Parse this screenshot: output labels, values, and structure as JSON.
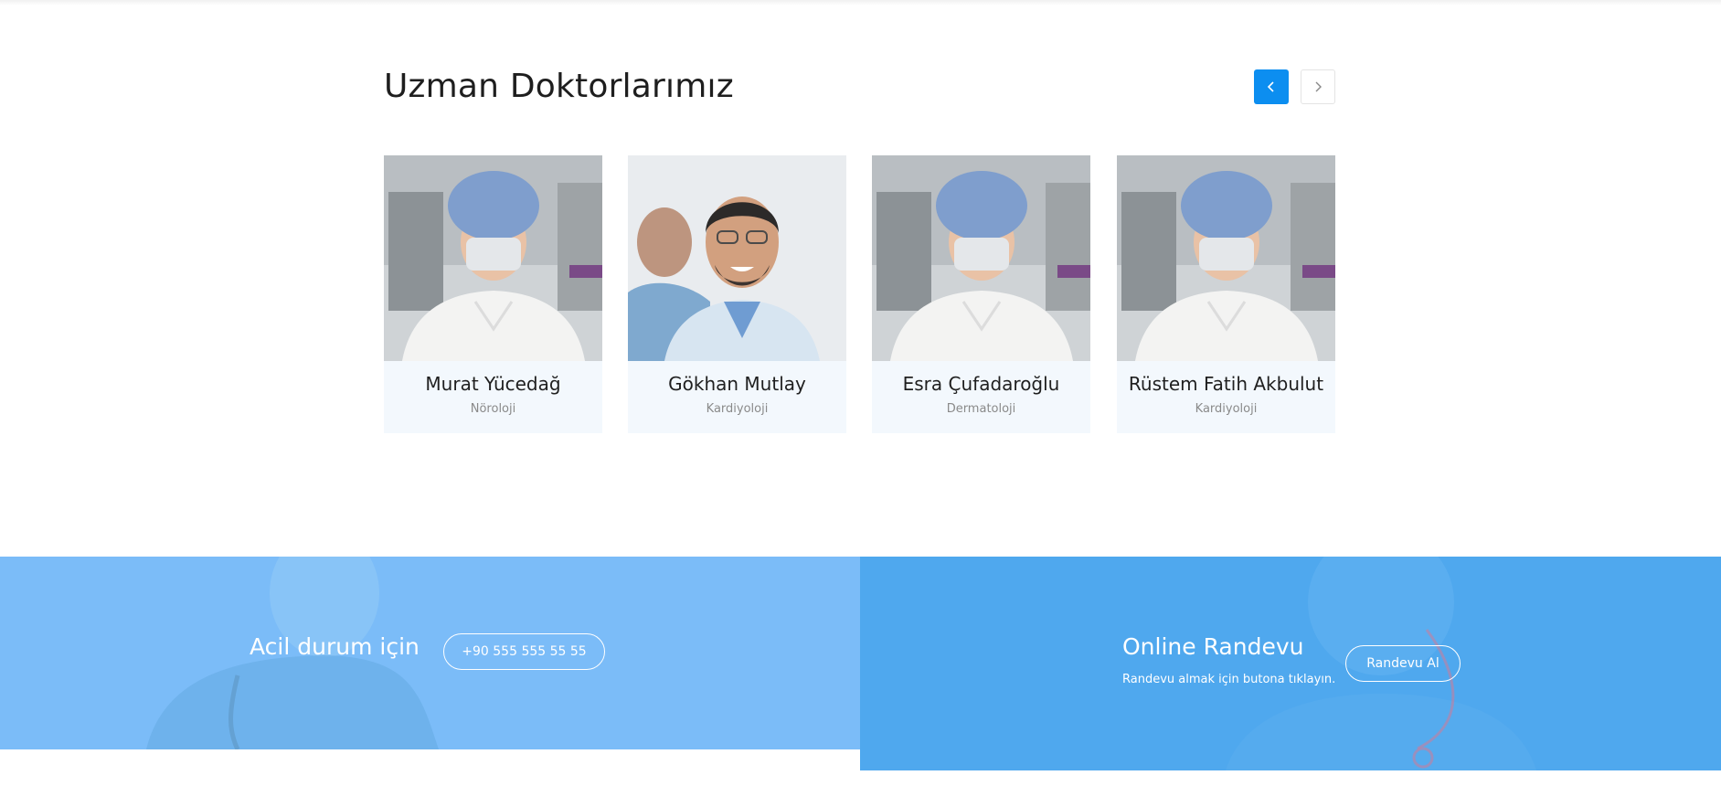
{
  "doctors_section": {
    "title": "Uzman Doktorlarımız",
    "prev_icon": "chevron-left-icon",
    "next_icon": "chevron-right-icon",
    "accent_color": "#0c8ef0",
    "doctors": [
      {
        "name": "Murat Yücedağ",
        "department": "Nöroloji"
      },
      {
        "name": "Gökhan Mutlay",
        "department": "Kardiyoloji"
      },
      {
        "name": "Esra Çufadaroğlu",
        "department": "Dermatoloji"
      },
      {
        "name": "Rüstem Fatih Akbulut",
        "department": "Kardiyoloji"
      }
    ]
  },
  "emergency": {
    "title": "Acil durum için",
    "phone": "+90 555 555 55 55",
    "background_color": "#7bbcf8"
  },
  "online_appointment": {
    "title": "Online Randevu",
    "subtitle": "Randevu almak için butona tıklayın.",
    "button_label": "Randevu Al",
    "background_color": "#4fa8ee"
  }
}
